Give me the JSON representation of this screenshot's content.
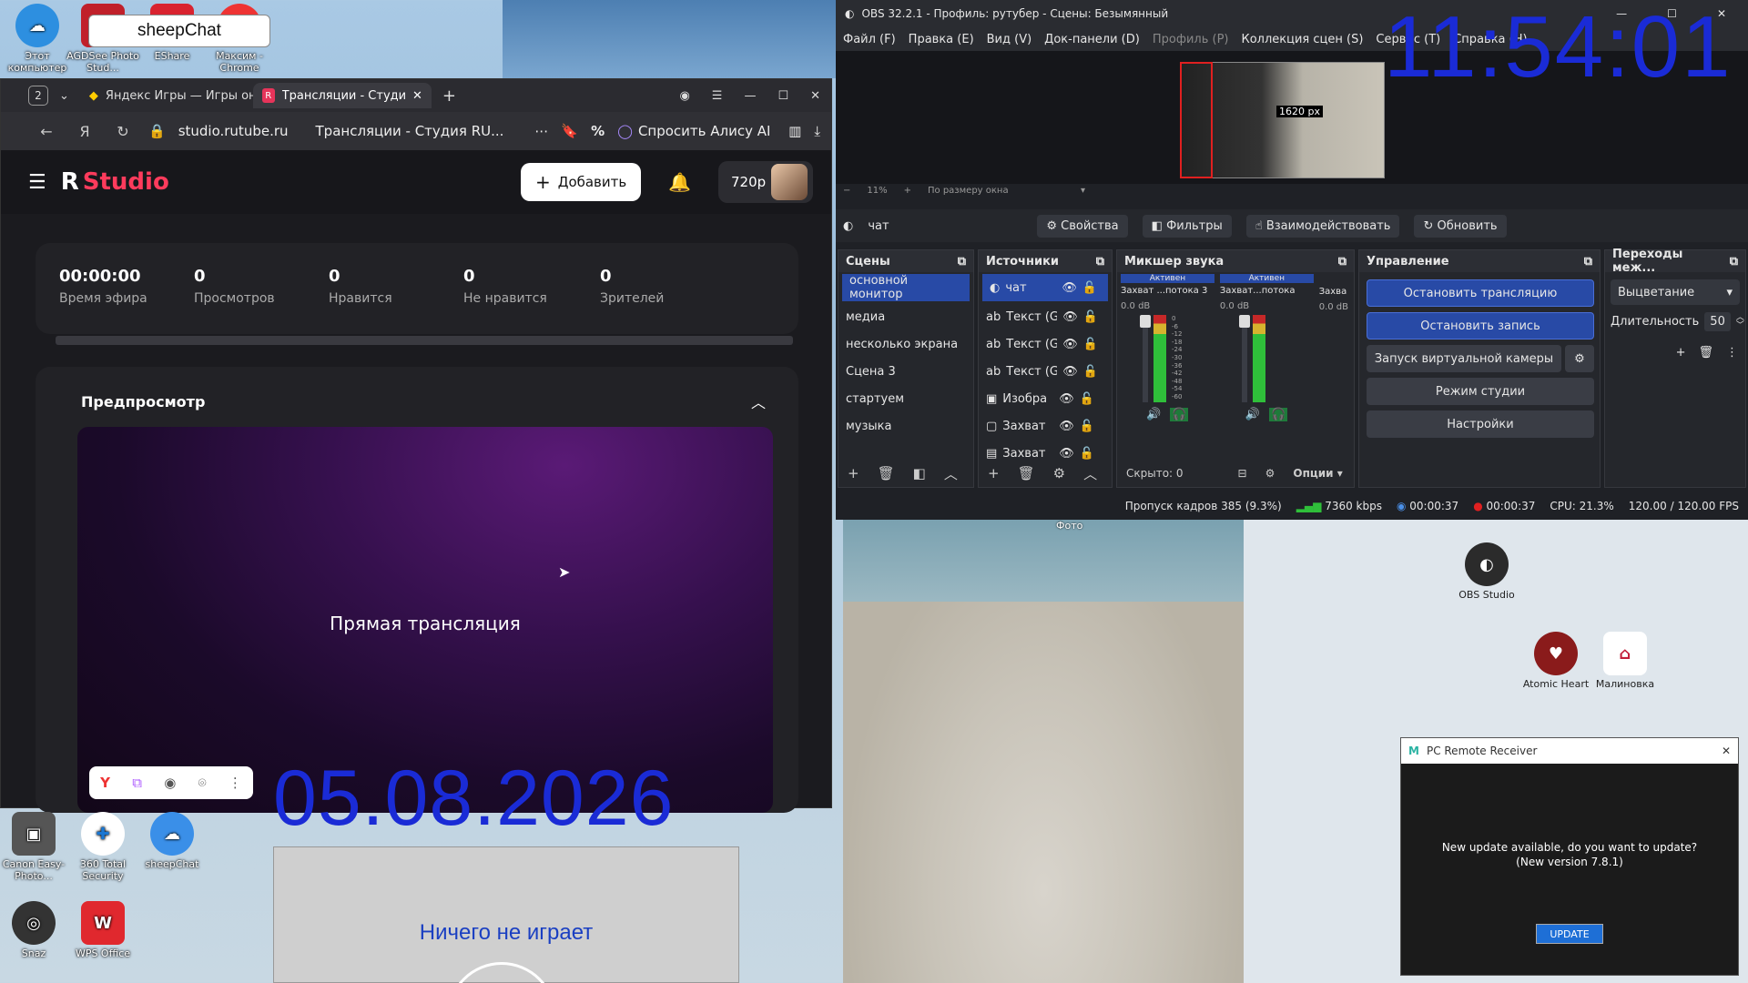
{
  "desktop": {
    "sheepchat_tooltip": "sheepChat",
    "top_labels": [
      "Этот компьютер",
      "AGDSee Photo Stud...",
      "EShare",
      "Максим - Chrome"
    ],
    "icons_bottom": [
      {
        "label": "Canon Easy-Photo..."
      },
      {
        "label": "360 Total Security"
      },
      {
        "label": "sheepChat"
      },
      {
        "label": "Snaz"
      },
      {
        "label": "WPS Office"
      }
    ],
    "icons_right": [
      {
        "label": "OBS Studio"
      },
      {
        "label": "Atomic Heart"
      },
      {
        "label": "Малиновка"
      }
    ],
    "beach_caption": "Фото",
    "date_overlay": "05.08.2026",
    "clock_overlay": "11:54:01",
    "now_playing": "Ничего не играет"
  },
  "browser": {
    "tab_count": "2",
    "tabs": [
      {
        "label": "Яндекс Игры — Игры онл"
      },
      {
        "label": "Трансляции - Студия R"
      }
    ],
    "address": "studio.rutube.ru",
    "page_title": "Трансляции - Студия RU...",
    "alice_label": "Спросить Алису AI",
    "studio": {
      "logo": "Studio",
      "add_label": "Добавить",
      "quality": "720p",
      "stats": [
        {
          "value": "00:00:00",
          "label": "Время эфира"
        },
        {
          "value": "0",
          "label": "Просмотров"
        },
        {
          "value": "0",
          "label": "Нравится"
        },
        {
          "value": "0",
          "label": "Не нравится"
        },
        {
          "value": "0",
          "label": "Зрителей"
        }
      ],
      "preview_title": "Предпросмотр",
      "live_label": "Прямая трансляция"
    }
  },
  "obs": {
    "title": "OBS 32.2.1 - Профиль: рутубер - Сцены: Безымянный",
    "menu": [
      "Файл (F)",
      "Правка (E)",
      "Вид (V)",
      "Док-панели (D)",
      "Профиль (P)",
      "Коллекция сцен (S)",
      "Сервис (T)",
      "Справка (H)"
    ],
    "preview_size_label": "1620 px",
    "zoom": "11%",
    "fit_label": "По размеру окна",
    "selected_source": "чат",
    "toolbar": [
      "Свойства",
      "Фильтры",
      "Взаимодействовать",
      "Обновить"
    ],
    "scenes_title": "Сцены",
    "scenes": [
      "основной монитор",
      "медиа",
      "несколько экрана",
      "Сцена 3",
      "стартуем",
      "музыка"
    ],
    "sources_title": "Источники",
    "sources": [
      "чат",
      "Текст (G",
      "Текст (G",
      "Текст (G",
      "Изобра",
      "Захват",
      "Захват"
    ],
    "mixer_title": "Микшер звука",
    "mixer_channels": [
      {
        "name": "Захват ...потока 3",
        "status": "Активен",
        "db": "0.0 dB"
      },
      {
        "name": "Захват...потока",
        "status": "Активен",
        "db": "0.0 dB"
      },
      {
        "name": "Захва",
        "status": "",
        "db": "0.0 dB"
      }
    ],
    "mixer_ticks": [
      "0",
      "-6",
      "-12",
      "-18",
      "-24",
      "-30",
      "-36",
      "-42",
      "-48",
      "-54",
      "-60"
    ],
    "hidden_label": "Скрыто: 0",
    "options_label": "Опции",
    "controls_title": "Управление",
    "controls": [
      "Остановить трансляцию",
      "Остановить запись",
      "Запуск виртуальной камеры",
      "Режим студии",
      "Настройки"
    ],
    "transitions_title": "Переходы меж...",
    "transition_value": "Выцветание",
    "duration_label": "Длительность",
    "duration_value": "50",
    "status": {
      "dropped": "Пропуск кадров 385 (9.3%)",
      "bitrate": "7360 kbps",
      "stream_time": "00:00:37",
      "rec_time": "00:00:37",
      "cpu": "CPU: 21.3%",
      "fps": "120.00 / 120.00 FPS"
    },
    "colors": {
      "accent": "#284aa6",
      "meter_green": "#2fbf3a",
      "meter_red": "#c62828"
    }
  },
  "notification": {
    "app": "PC Remote Receiver",
    "message": "New update available, do you want to update?(New version 7.8.1)",
    "button": "UPDATE"
  }
}
